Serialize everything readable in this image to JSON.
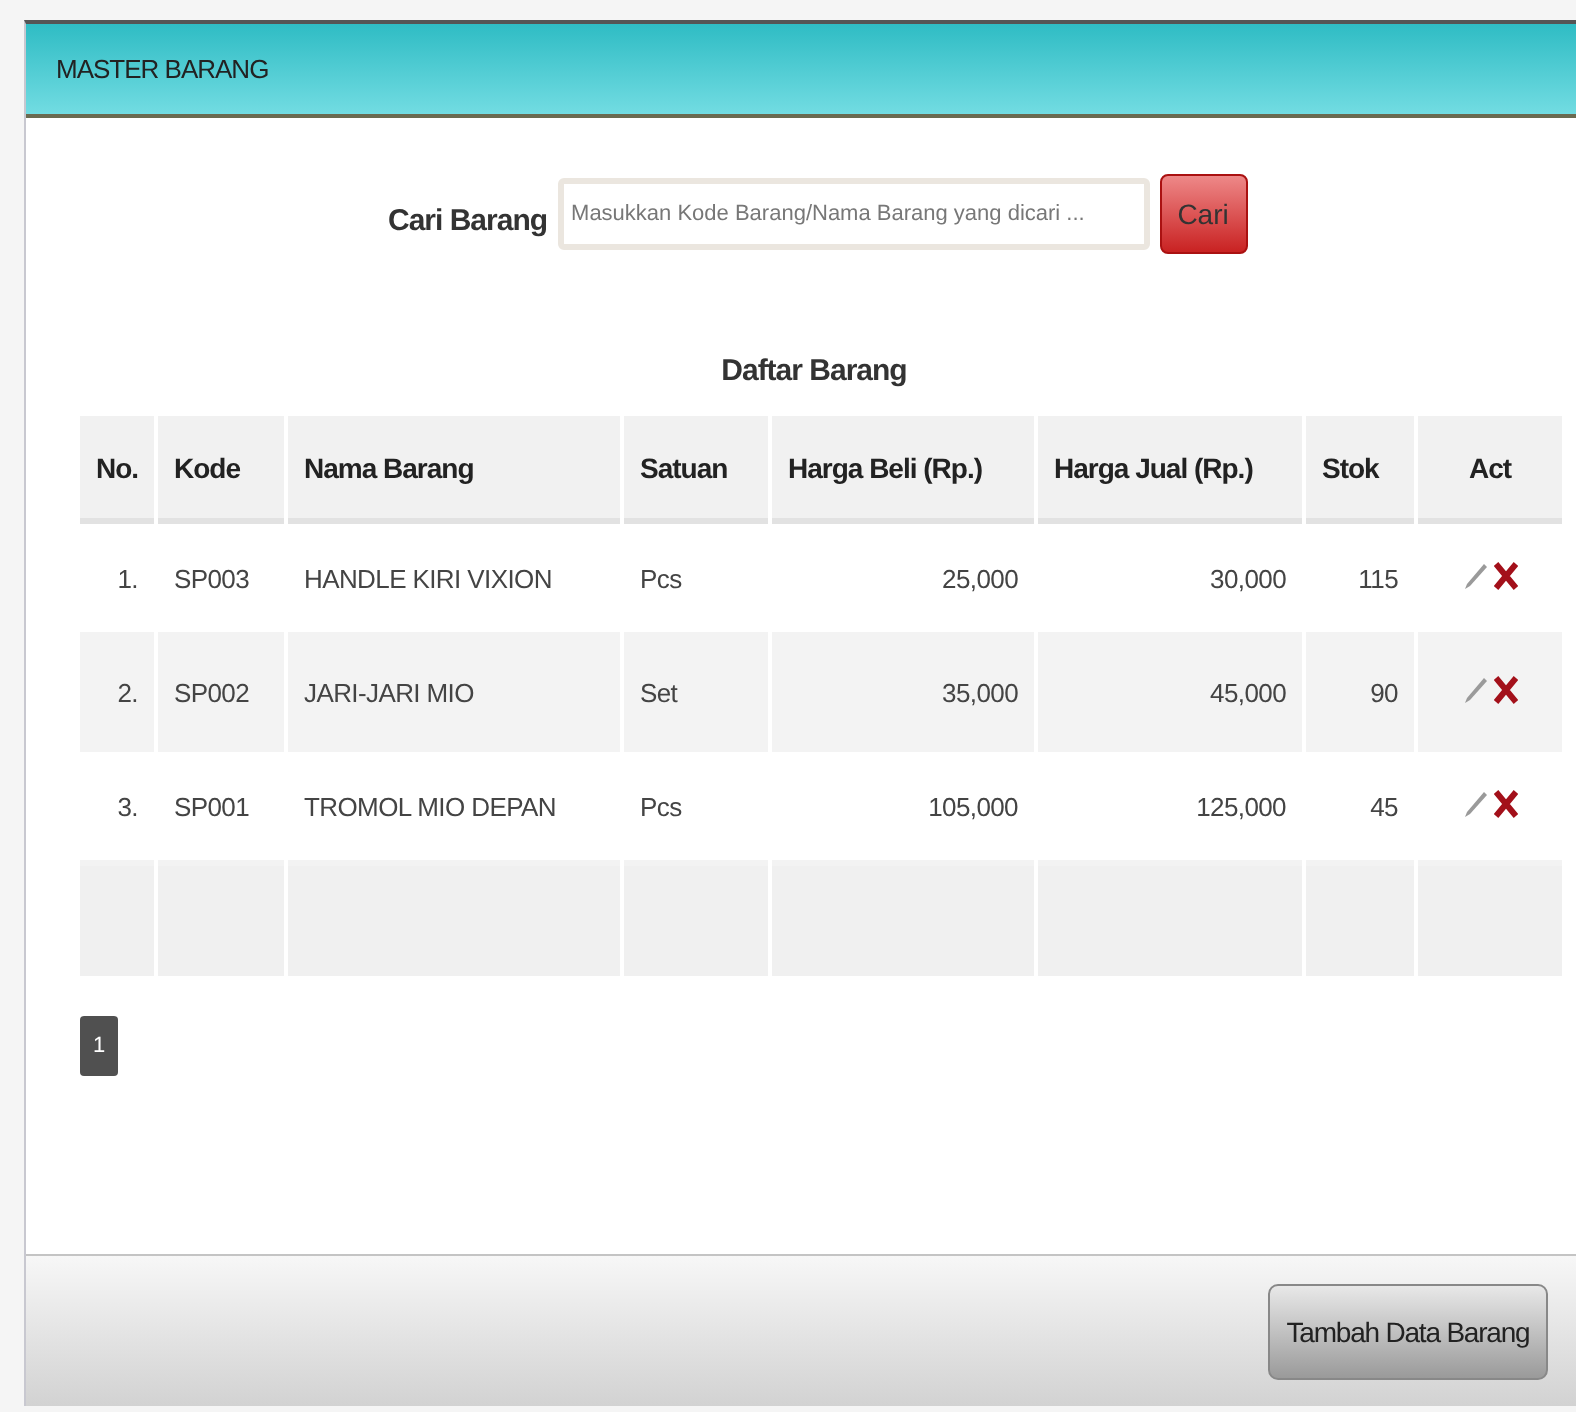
{
  "panel": {
    "title": "MASTER BARANG"
  },
  "search": {
    "label": "Cari Barang",
    "placeholder": "Masukkan Kode Barang/Nama Barang yang dicari ...",
    "button": "Cari"
  },
  "table": {
    "title": "Daftar Barang",
    "columns": [
      "No.",
      "Kode",
      "Nama Barang",
      "Satuan",
      "Harga Beli (Rp.)",
      "Harga Jual (Rp.)",
      "Stok",
      "Act"
    ],
    "rows": [
      {
        "no": "1.",
        "kode": "SP003",
        "nama": "HANDLE KIRI VIXION",
        "satuan": "Pcs",
        "harga_beli": "25,000",
        "harga_jual": "30,000",
        "stok": "115"
      },
      {
        "no": "2.",
        "kode": "SP002",
        "nama": "JARI-JARI MIO",
        "satuan": "Set",
        "harga_beli": "35,000",
        "harga_jual": "45,000",
        "stok": "90"
      },
      {
        "no": "3.",
        "kode": "SP001",
        "nama": "TROMOL MIO DEPAN",
        "satuan": "Pcs",
        "harga_beli": "105,000",
        "harga_jual": "125,000",
        "stok": "45"
      }
    ]
  },
  "pagination": [
    {
      "label": "1",
      "selected": true
    }
  ],
  "footer": {
    "button": "Tambah Data Barang"
  }
}
